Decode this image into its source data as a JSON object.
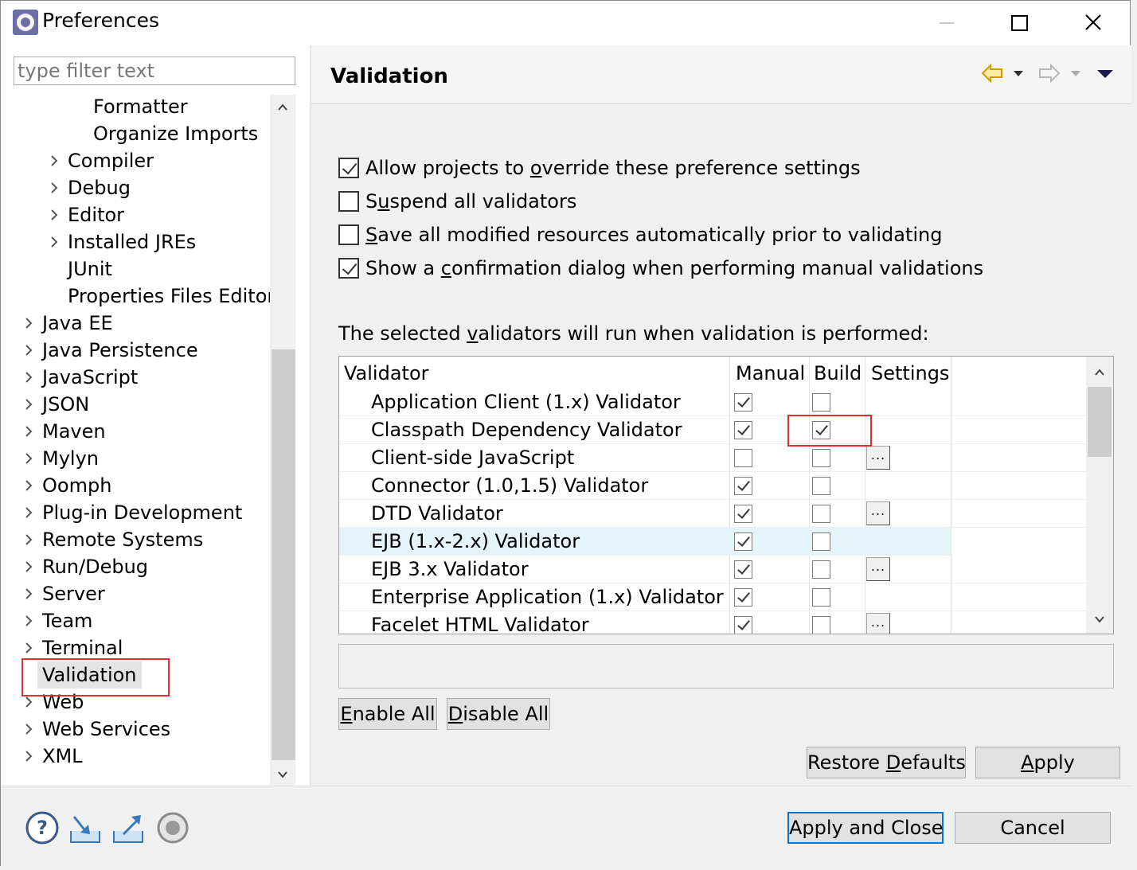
{
  "window": {
    "title": "Preferences"
  },
  "filter": {
    "placeholder": "type filter text"
  },
  "tree": [
    {
      "label": "Formatter",
      "level": 3,
      "expandable": false,
      "selected": false
    },
    {
      "label": "Organize Imports",
      "level": 3,
      "expandable": false,
      "selected": false
    },
    {
      "label": "Compiler",
      "level": 2,
      "expandable": true,
      "selected": false
    },
    {
      "label": "Debug",
      "level": 2,
      "expandable": true,
      "selected": false
    },
    {
      "label": "Editor",
      "level": 2,
      "expandable": true,
      "selected": false
    },
    {
      "label": "Installed JREs",
      "level": 2,
      "expandable": true,
      "selected": false
    },
    {
      "label": "JUnit",
      "level": 2,
      "expandable": false,
      "selected": false
    },
    {
      "label": "Properties Files Editor",
      "level": 2,
      "expandable": false,
      "selected": false
    },
    {
      "label": "Java EE",
      "level": 1,
      "expandable": true,
      "selected": false
    },
    {
      "label": "Java Persistence",
      "level": 1,
      "expandable": true,
      "selected": false
    },
    {
      "label": "JavaScript",
      "level": 1,
      "expandable": true,
      "selected": false
    },
    {
      "label": "JSON",
      "level": 1,
      "expandable": true,
      "selected": false
    },
    {
      "label": "Maven",
      "level": 1,
      "expandable": true,
      "selected": false
    },
    {
      "label": "Mylyn",
      "level": 1,
      "expandable": true,
      "selected": false
    },
    {
      "label": "Oomph",
      "level": 1,
      "expandable": true,
      "selected": false
    },
    {
      "label": "Plug-in Development",
      "level": 1,
      "expandable": true,
      "selected": false
    },
    {
      "label": "Remote Systems",
      "level": 1,
      "expandable": true,
      "selected": false
    },
    {
      "label": "Run/Debug",
      "level": 1,
      "expandable": true,
      "selected": false
    },
    {
      "label": "Server",
      "level": 1,
      "expandable": true,
      "selected": false
    },
    {
      "label": "Team",
      "level": 1,
      "expandable": true,
      "selected": false
    },
    {
      "label": "Terminal",
      "level": 1,
      "expandable": true,
      "selected": false
    },
    {
      "label": "Validation",
      "level": 1,
      "expandable": false,
      "selected": true
    },
    {
      "label": "Web",
      "level": 1,
      "expandable": true,
      "selected": false
    },
    {
      "label": "Web Services",
      "level": 1,
      "expandable": true,
      "selected": false
    },
    {
      "label": "XML",
      "level": 1,
      "expandable": true,
      "selected": false
    }
  ],
  "page": {
    "title": "Validation"
  },
  "options": [
    {
      "before": "Allow projects to ",
      "mn": "o",
      "after": "verride these preference settings",
      "checked": true
    },
    {
      "before": "S",
      "mn": "u",
      "after": "spend all validators",
      "checked": false
    },
    {
      "before": "",
      "mn": "S",
      "after": "ave all modified resources automatically prior to validating",
      "checked": false
    },
    {
      "before": "Show a ",
      "mn": "c",
      "after": "onfirmation dialog when performing manual validations",
      "checked": true
    }
  ],
  "validators_label": {
    "before": "The selected ",
    "mn": "v",
    "after": "alidators will run when validation is performed:"
  },
  "table": {
    "headers": {
      "validator": "Validator",
      "manual": "Manual",
      "build": "Build",
      "settings": "Settings"
    },
    "rows": [
      {
        "name": "Application Client (1.x) Validator",
        "manual": true,
        "build": false,
        "settings": false,
        "highlight": false
      },
      {
        "name": "Classpath Dependency Validator",
        "manual": true,
        "build": true,
        "settings": false,
        "highlight": false
      },
      {
        "name": "Client-side JavaScript",
        "manual": false,
        "build": false,
        "settings": true,
        "highlight": false
      },
      {
        "name": "Connector (1.0,1.5) Validator",
        "manual": true,
        "build": false,
        "settings": false,
        "highlight": false
      },
      {
        "name": "DTD Validator",
        "manual": true,
        "build": false,
        "settings": true,
        "highlight": false
      },
      {
        "name": "EJB (1.x-2.x) Validator",
        "manual": true,
        "build": false,
        "settings": false,
        "highlight": true
      },
      {
        "name": "EJB 3.x Validator",
        "manual": true,
        "build": false,
        "settings": true,
        "highlight": false
      },
      {
        "name": "Enterprise Application (1.x) Validator",
        "manual": true,
        "build": false,
        "settings": false,
        "highlight": false
      },
      {
        "name": "Facelet HTML Validator",
        "manual": true,
        "build": false,
        "settings": true,
        "highlight": false
      }
    ],
    "settings_button": "..."
  },
  "buttons": {
    "enable_all": {
      "before": "",
      "mn": "E",
      "after": "nable All"
    },
    "disable_all": {
      "before": "",
      "mn": "D",
      "after": "isable All"
    },
    "restore_defaults": {
      "before": "Restore ",
      "mn": "D",
      "after": "efaults"
    },
    "apply": {
      "before": "",
      "mn": "A",
      "after": "pply"
    },
    "apply_and_close": "Apply and Close",
    "cancel": "Cancel"
  },
  "icons": {
    "app": "eclipse-icon",
    "nav_back": "back-arrow-icon",
    "nav_forward": "forward-arrow-icon",
    "view_menu": "view-menu-icon",
    "help": "help-icon",
    "import": "import-icon",
    "export": "export-icon",
    "oomph": "record-icon"
  },
  "colors": {
    "highlight_box": "#e0312f",
    "row_highlight": "#e5f3fb",
    "default_button_border": "#0078d7",
    "nav_back": "#f0b400"
  }
}
